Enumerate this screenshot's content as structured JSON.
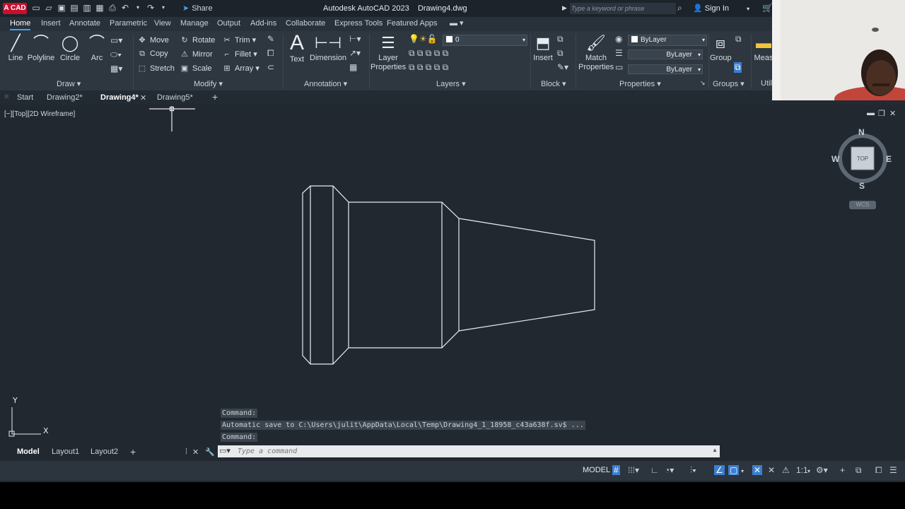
{
  "titlebar": {
    "logo_text": "A CAD",
    "share_label": "Share",
    "app_name": "Autodesk AutoCAD 2023",
    "document": "Drawing4.dwg",
    "search_placeholder": "Type a keyword or phrase",
    "signin_label": "Sign In"
  },
  "ribbon_tabs": [
    "Home",
    "Insert",
    "Annotate",
    "Parametric",
    "View",
    "Manage",
    "Output",
    "Add-ins",
    "Collaborate",
    "Express Tools",
    "Featured Apps"
  ],
  "draw": {
    "title": "Draw",
    "line": "Line",
    "polyline": "Polyline",
    "circle": "Circle",
    "arc": "Arc"
  },
  "modify": {
    "title": "Modify",
    "move": "Move",
    "rotate": "Rotate",
    "trim": "Trim",
    "copy": "Copy",
    "mirror": "Mirror",
    "fillet": "Fillet",
    "stretch": "Stretch",
    "scale": "Scale",
    "array": "Array"
  },
  "annotation": {
    "title": "Annotation",
    "text": "Text",
    "dimension": "Dimension"
  },
  "layers": {
    "title": "Layers",
    "layer_properties_1": "Layer",
    "layer_properties_2": "Properties",
    "current_layer": "0"
  },
  "block": {
    "title": "Block",
    "insert": "Insert"
  },
  "properties": {
    "title": "Properties",
    "match_1": "Match",
    "match_2": "Properties",
    "color": "ByLayer",
    "linetype": "ByLayer",
    "lineweight": "ByLayer"
  },
  "groups": {
    "title": "Groups",
    "group": "Group"
  },
  "utilities": {
    "measure": "Meas",
    "util": "Util"
  },
  "doc_tabs": [
    "Start",
    "Drawing2*",
    "Drawing4*",
    "Drawing5*"
  ],
  "viewport": {
    "label": "[−][Top][2D Wireframe]"
  },
  "viewcube": {
    "n": "N",
    "s": "S",
    "e": "E",
    "w": "W",
    "face": "TOP",
    "wcs": "WCS"
  },
  "ucs": {
    "x": "X",
    "y": "Y"
  },
  "command_history": [
    "Command:",
    "Automatic save to C:\\Users\\julit\\AppData\\Local\\Temp\\Drawing4_1_18958_c43a638f.sv$ ...",
    "Command:"
  ],
  "command": {
    "placeholder": "Type a command"
  },
  "layout_tabs": [
    "Model",
    "Layout1",
    "Layout2"
  ],
  "status": {
    "model": "MODEL",
    "scale": "1:1"
  }
}
